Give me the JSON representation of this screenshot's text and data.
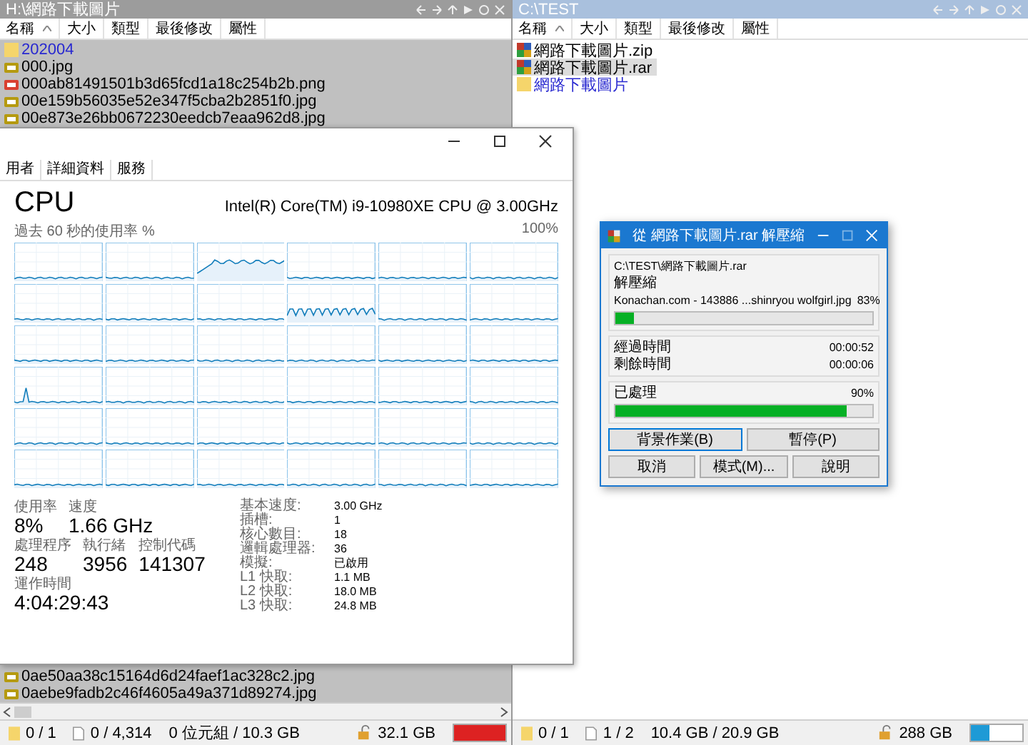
{
  "panes": [
    {
      "title": "H:\\網路下載圖片",
      "active": false,
      "columns": [
        {
          "label": "名稱",
          "sorted": true
        },
        {
          "label": "大小",
          "sorted": false
        },
        {
          "label": "類型",
          "sorted": false
        },
        {
          "label": "最後修改",
          "sorted": false
        },
        {
          "label": "屬性",
          "sorted": false
        }
      ],
      "files": [
        {
          "name": "202004",
          "kind": "folder",
          "selected": false
        },
        {
          "name": "000.jpg",
          "kind": "jpg",
          "selected": false
        },
        {
          "name": "000ab81491501b3d65fcd1a18c254b2b.png",
          "kind": "png",
          "selected": false
        },
        {
          "name": "00e159b56035e52e347f5cba2b2851f0.jpg",
          "kind": "jpg",
          "selected": false
        },
        {
          "name": "00e873e26bb0672230eedcb7eaa962d8.jpg",
          "kind": "jpg",
          "selected": false
        }
      ],
      "files_after_gap": [
        {
          "name": "0ae50aa38c15164d6d24faef1ac328c2.jpg",
          "kind": "jpg",
          "selected": false
        },
        {
          "name": "0aebe9fadb2c46f4605a49a371d89274.jpg",
          "kind": "jpg",
          "selected": false
        }
      ],
      "horizontal_scrollbar": true,
      "status": {
        "folders": "0 / 1",
        "files": "0 / 4,314",
        "size": "0 位元組 / 10.3 GB",
        "free": "32.1 GB",
        "level": 1,
        "color": "#dd2222"
      }
    },
    {
      "title": "C:\\TEST",
      "active": true,
      "columns": [
        {
          "label": "名稱",
          "sorted": true
        },
        {
          "label": "大小",
          "sorted": false
        },
        {
          "label": "類型",
          "sorted": false
        },
        {
          "label": "最後修改",
          "sorted": false
        },
        {
          "label": "屬性",
          "sorted": false
        }
      ],
      "files": [
        {
          "name": "網路下載圖片.zip",
          "kind": "archive",
          "selected": false
        },
        {
          "name": "網路下載圖片.rar",
          "kind": "archive",
          "selected": true
        },
        {
          "name": "網路下載圖片",
          "kind": "folder",
          "selected": false
        }
      ],
      "horizontal_scrollbar": false,
      "status": {
        "folders": "0 / 1",
        "files": "1 / 2",
        "size": "10.4 GB / 20.9 GB",
        "free": "288 GB",
        "level": 0.35,
        "color": "#1e9ad6"
      }
    }
  ],
  "task_manager": {
    "tabs": [
      {
        "label": "用者",
        "selected": false
      },
      {
        "label": "詳細資料",
        "selected": false
      },
      {
        "label": "服務",
        "selected": false
      }
    ],
    "title": "CPU",
    "model": "Intel(R) Core(TM) i9-10980XE CPU @ 3.00GHz",
    "graph_caption": "過去 60 秒的使用率 %",
    "graph_max": "100%",
    "stat_rows": [
      [
        {
          "label": "使用率",
          "value": "8%"
        },
        {
          "label": "速度",
          "value": "1.66 GHz"
        }
      ],
      [
        {
          "label": "處理程序",
          "value": "248"
        },
        {
          "label": "執行緒",
          "value": "3956"
        },
        {
          "label": "控制代碼",
          "value": "141307"
        }
      ],
      [
        {
          "label": "運作時間",
          "value": "4:04:29:43"
        }
      ]
    ],
    "specs": [
      {
        "label": "基本速度:",
        "value": "3.00 GHz"
      },
      {
        "label": "插槽:",
        "value": "1"
      },
      {
        "label": "核心數目:",
        "value": "18"
      },
      {
        "label": "邏輯處理器:",
        "value": "36"
      },
      {
        "label": "模擬:",
        "value": "已啟用"
      },
      {
        "label": "L1 快取:",
        "value": "1.1 MB"
      },
      {
        "label": "L2 快取:",
        "value": "18.0 MB"
      },
      {
        "label": "L3 快取:",
        "value": "24.8 MB"
      }
    ]
  },
  "extract_dialog": {
    "title": "從 網路下載圖片.rar 解壓縮",
    "archive_path": "C:\\TEST\\網路下載圖片.rar",
    "action": "解壓縮",
    "current_file": "Konachan.com - 143886 ...shinryou wolfgirl.jpg",
    "file_percent": "83%",
    "file_progress": {
      "level": 0.07
    },
    "times": [
      {
        "label": "經過時間",
        "value": "00:00:52"
      },
      {
        "label": "剩餘時間",
        "value": "00:00:06"
      }
    ],
    "processed_label": "已處理",
    "processed_percent": "90%",
    "processed_progress": {
      "level": 0.9
    },
    "button_rows": [
      [
        {
          "label": "背景作業(B)",
          "focused": true
        },
        {
          "label": "暫停(P)",
          "focused": false
        }
      ],
      [
        {
          "label": "取消",
          "focused": false
        },
        {
          "label": "模式(M)...",
          "focused": false
        },
        {
          "label": "說明",
          "focused": false
        }
      ]
    ]
  }
}
